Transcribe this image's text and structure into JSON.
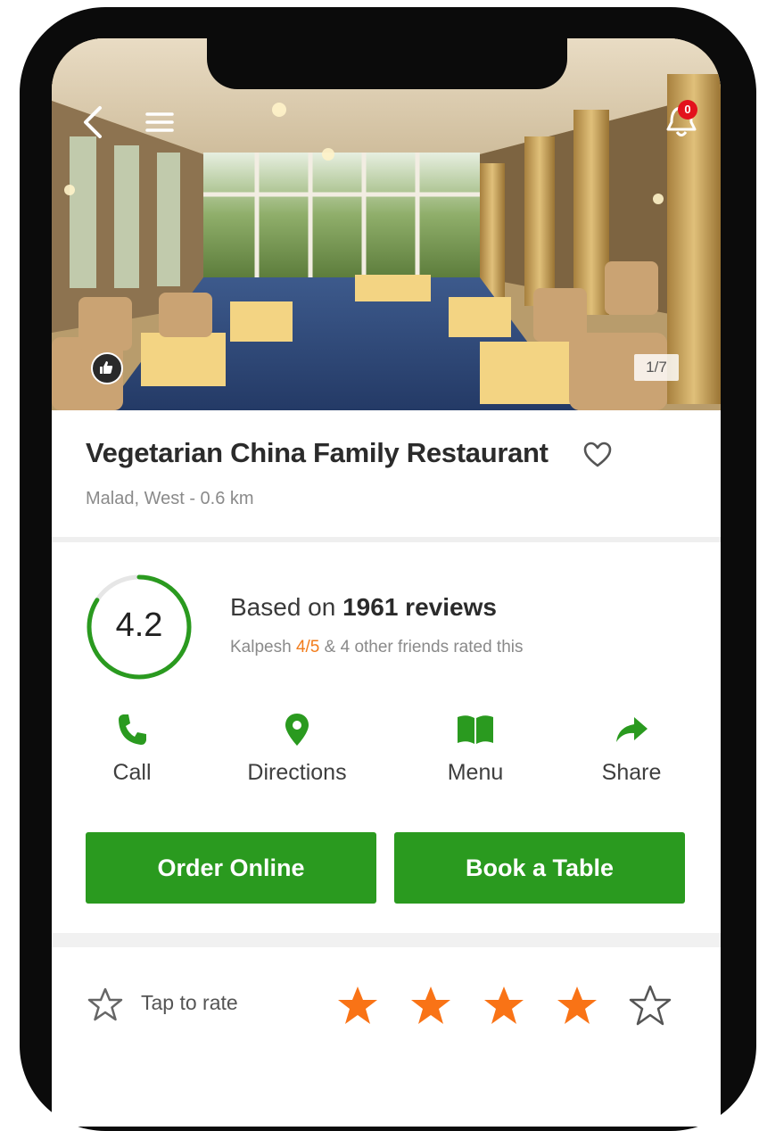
{
  "hero": {
    "photo_counter": "1/7",
    "notification_count": "0"
  },
  "restaurant": {
    "name": "Vegetarian China Family Restaurant",
    "location": "Malad, West - 0.6 km"
  },
  "rating": {
    "value": "4.2",
    "fraction": 0.84,
    "reviews_prefix": "Based on ",
    "reviews_count": "1961 reviews",
    "friend_name": "Kalpesh ",
    "friend_score": "4/5",
    "friends_suffix": " & 4 other friends rated this",
    "accent_color": "#2a9a1f",
    "friend_score_color": "#f27c1b"
  },
  "actions": [
    {
      "label": "Call",
      "icon": "phone-icon"
    },
    {
      "label": "Directions",
      "icon": "map-pin-icon"
    },
    {
      "label": "Menu",
      "icon": "book-icon"
    },
    {
      "label": "Share",
      "icon": "share-arrow-icon"
    }
  ],
  "buttons": {
    "order_online": "Order Online",
    "book_table": "Book a Table",
    "color": "#2a9a1f"
  },
  "tap_to_rate": {
    "label": "Tap to rate",
    "stars_filled": 4,
    "stars_total": 5,
    "star_color": "#f97316"
  }
}
